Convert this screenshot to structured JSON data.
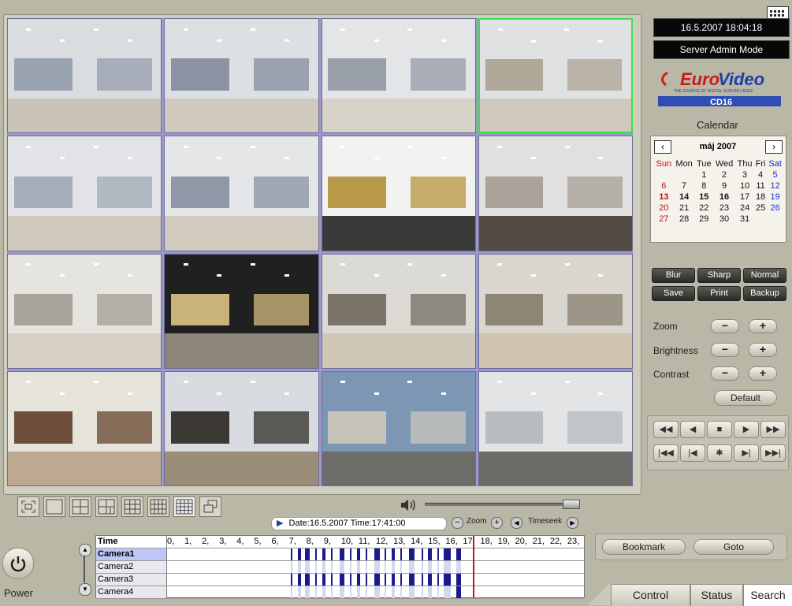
{
  "status": {
    "datetime": "16.5.2007 18:04:18",
    "mode": "Server Admin Mode"
  },
  "brand": {
    "name": "EuroVideo",
    "tagline": "THE SOURCE OF DIGITAL SURVEILLANCE",
    "model": "CD16"
  },
  "calendar": {
    "title": "Calendar",
    "month": "máj 2007",
    "days": [
      "Sun",
      "Mon",
      "Tue",
      "Wed",
      "Thu",
      "Fri",
      "Sat"
    ],
    "weeks": [
      [
        "",
        "",
        "1",
        "2",
        "3",
        "4",
        "5"
      ],
      [
        "6",
        "7",
        "8",
        "9",
        "10",
        "11",
        "12"
      ],
      [
        "13",
        "14",
        "15",
        "16",
        "17",
        "18",
        "19"
      ],
      [
        "20",
        "21",
        "22",
        "23",
        "24",
        "25",
        "26"
      ],
      [
        "27",
        "28",
        "29",
        "30",
        "31",
        "",
        ""
      ]
    ],
    "colors": {
      "sunday": "#c0101a",
      "saturday": "#1a2fd0"
    }
  },
  "image_buttons": {
    "blur": "Blur",
    "sharp": "Sharp",
    "normal": "Normal",
    "save": "Save",
    "print": "Print",
    "backup": "Backup"
  },
  "adjust": {
    "zoom": "Zoom",
    "brightness": "Brightness",
    "contrast": "Contrast",
    "default": "Default"
  },
  "timebar": {
    "date_time": "Date:16.5.2007 Time:17:41:00",
    "zoom": "Zoom",
    "timeseek": "Timeseek"
  },
  "timeline": {
    "header": "Time",
    "hours": [
      "0",
      "1",
      "2",
      "3",
      "4",
      "5",
      "6",
      "7",
      "8",
      "9",
      "10",
      "11",
      "12",
      "13",
      "14",
      "15",
      "16",
      "17",
      "18",
      "19",
      "20",
      "21",
      "22",
      "23"
    ],
    "cameras": [
      "Camera1",
      "Camera2",
      "Camera3",
      "Camera4"
    ]
  },
  "actions": {
    "bookmark": "Bookmark",
    "goto": "Goto"
  },
  "power": {
    "label": "Power"
  },
  "tabs": [
    "Control",
    "Status",
    "Search"
  ],
  "accent": {
    "selected_camera": "#3ee04a",
    "record": "#1a1a8a",
    "cursor": "#cc1111"
  }
}
